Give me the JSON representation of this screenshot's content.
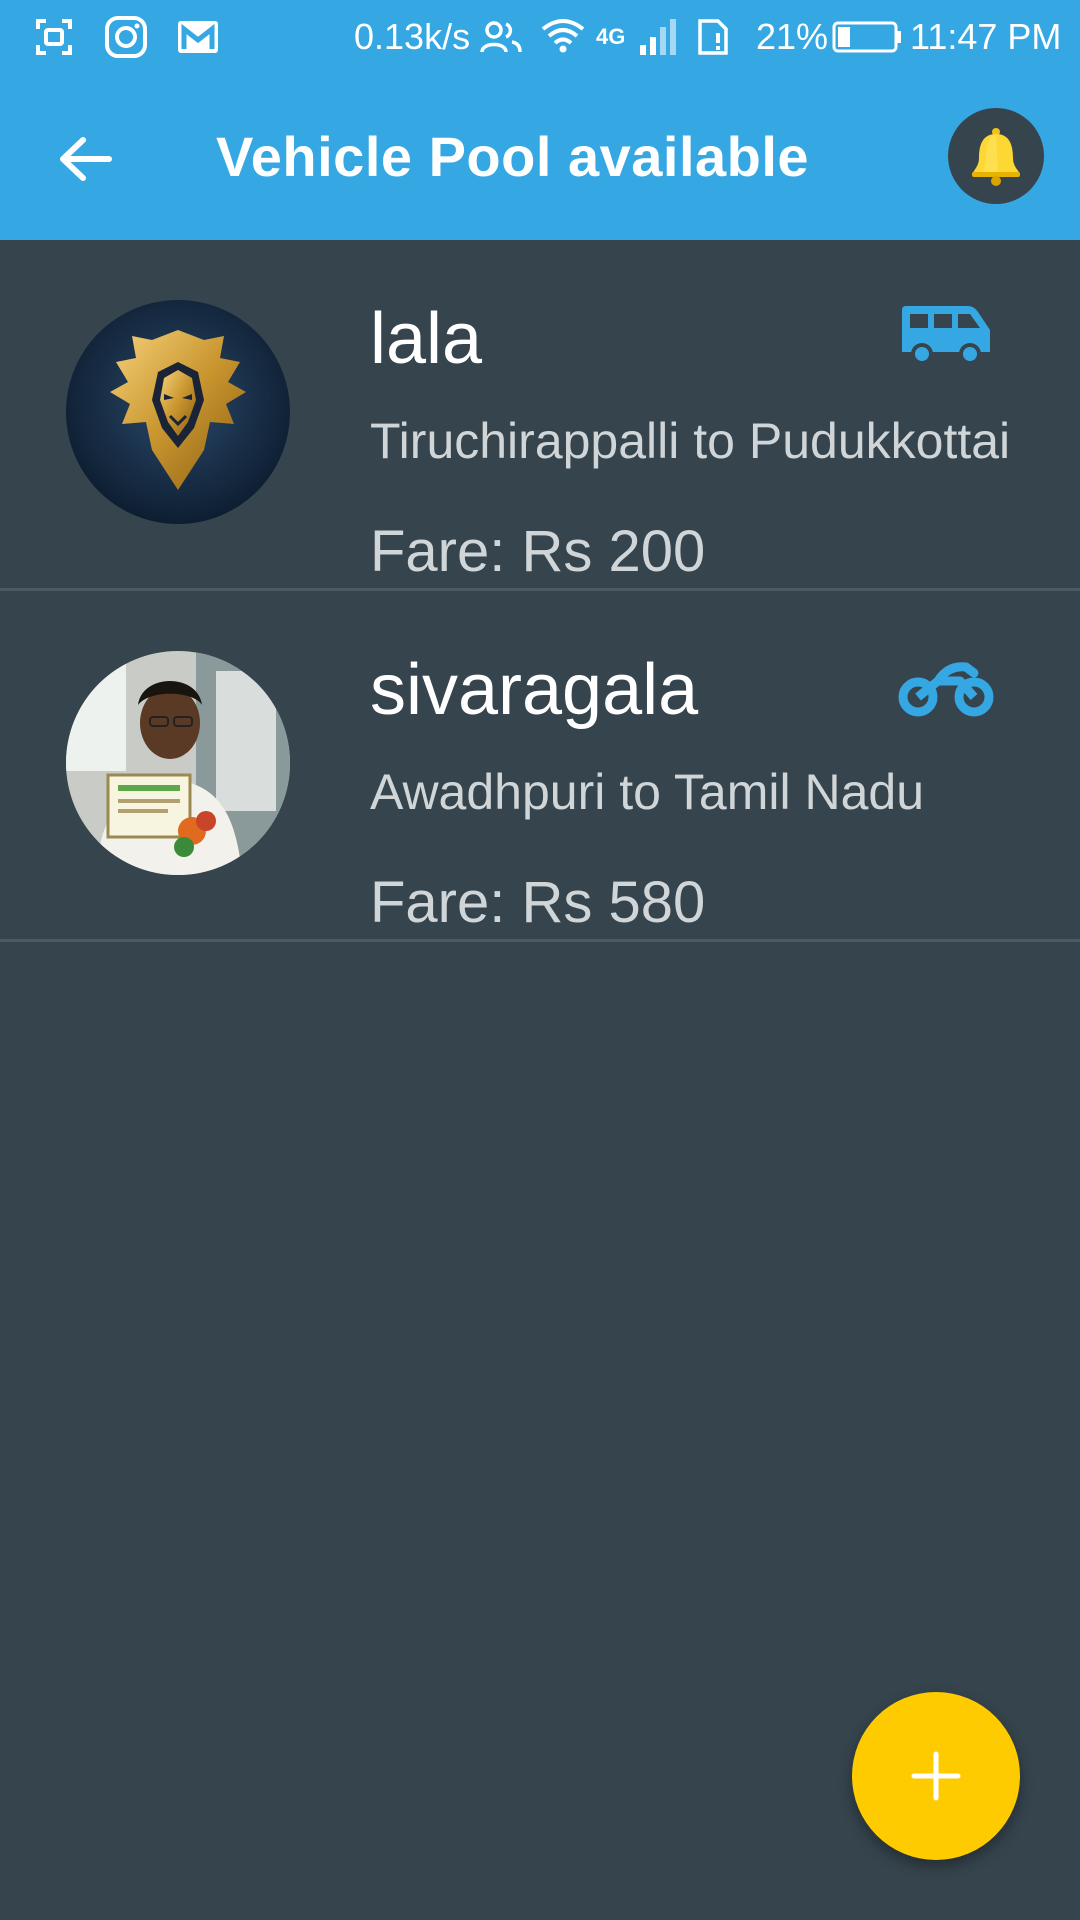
{
  "status_bar": {
    "net_speed": "0.13k/s",
    "network": "4G",
    "battery": "21%",
    "time": "11:47 PM"
  },
  "app_bar": {
    "title": "Vehicle Pool available"
  },
  "pools": [
    {
      "name": "lala",
      "route": "Tiruchirappalli to Pudukkottai",
      "fare": "Fare: Rs 200",
      "vehicle_icon": "van-icon"
    },
    {
      "name": "sivaragala",
      "route": "Awadhpuri to Tamil Nadu",
      "fare": "Fare: Rs 580",
      "vehicle_icon": "motorbike-icon"
    }
  ],
  "colors": {
    "primary": "#35a8e4",
    "background": "#36444d",
    "accent": "#fecb00",
    "vehicle_icon": "#35a8e4"
  },
  "fab": {
    "icon": "plus-icon"
  }
}
